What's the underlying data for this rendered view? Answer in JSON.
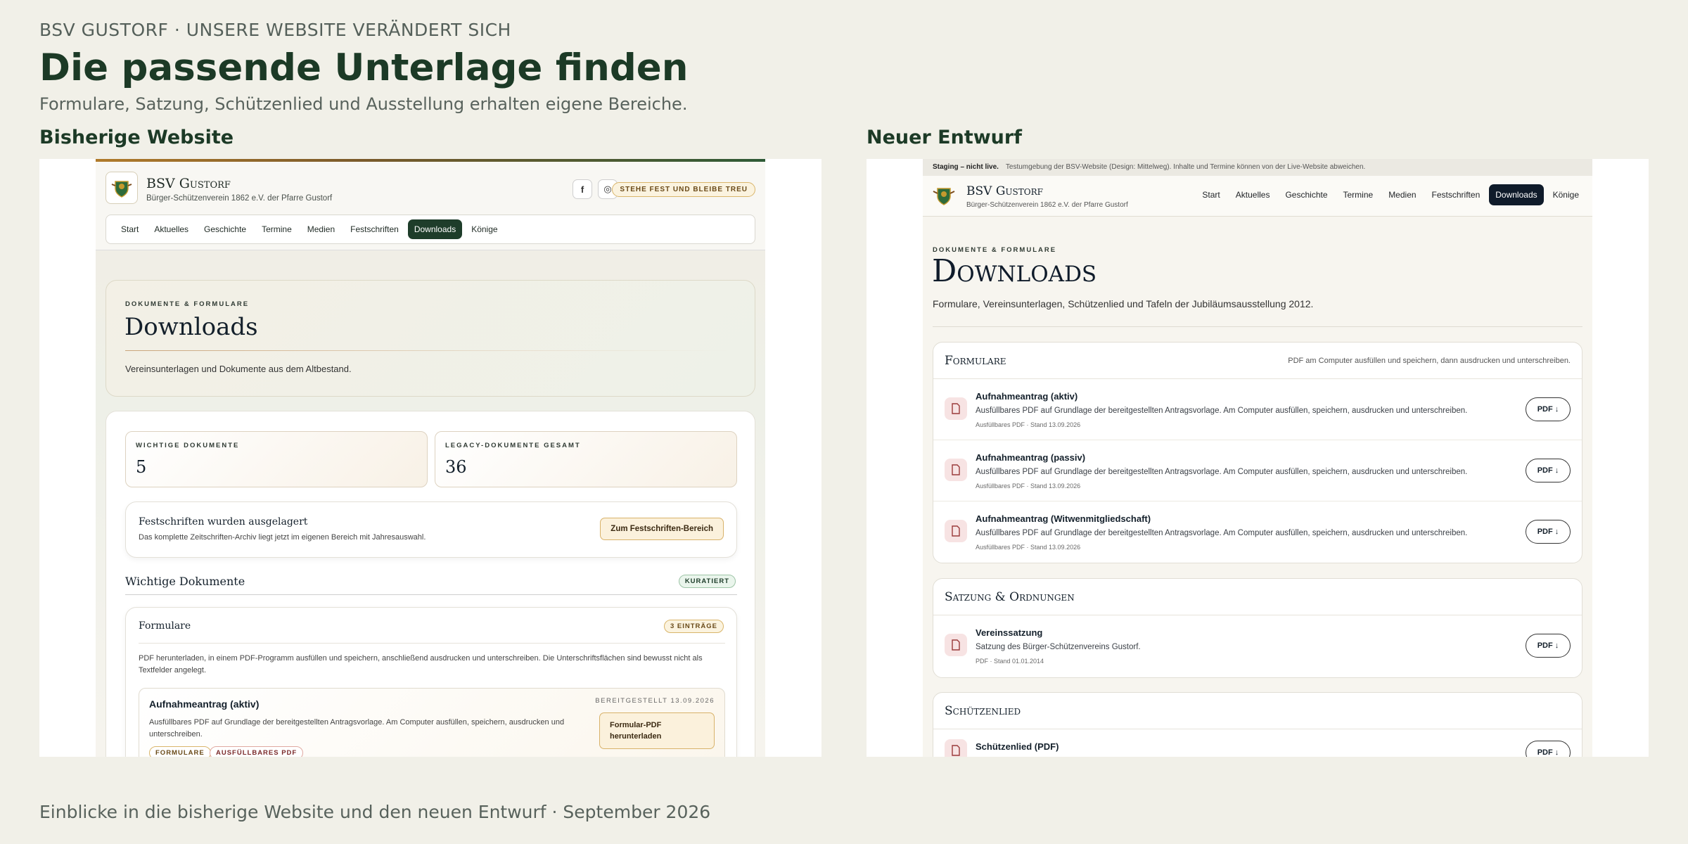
{
  "header": {
    "kicker": "BSV GUSTORF · UNSERE WEBSITE VERÄNDERT SICH",
    "title": "Die passende Unterlage finden",
    "subtitle": "Formulare, Satzung, Schützenlied und Ausstellung erhalten eigene Bereiche."
  },
  "columns": {
    "left": "Bisherige Website",
    "right": "Neuer Entwurf"
  },
  "footer": "Einblicke in die bisherige Website und den neuen Entwurf · September 2026",
  "old": {
    "brand": "BSV Gustorf",
    "tagline": "Bürger-Schützenverein 1862 e.V. der Pfarre Gustorf",
    "social": {
      "facebook": "f",
      "instagram": "◎"
    },
    "motto": "STEHE FEST UND BLEIBE TREU",
    "nav": [
      "Start",
      "Aktuelles",
      "Geschichte",
      "Termine",
      "Medien",
      "Festschriften",
      "Downloads",
      "Könige"
    ],
    "hero": {
      "eyebrow": "DOKUMENTE & FORMULARE",
      "title": "Downloads",
      "text": "Vereinsunterlagen und Dokumente aus dem Altbestand."
    },
    "stats": [
      {
        "label": "WICHTIGE DOKUMENTE",
        "value": "5"
      },
      {
        "label": "LEGACY-DOKUMENTE GESAMT",
        "value": "36"
      }
    ],
    "notice": {
      "title": "Festschriften wurden ausgelagert",
      "text": "Das komplette Zeitschriften-Archiv liegt jetzt im eigenen Bereich mit Jahresauswahl.",
      "button": "Zum Festschriften-Bereich"
    },
    "important": {
      "title": "Wichtige Dokumente",
      "badge": "KURATIERT"
    },
    "group": {
      "title": "Formulare",
      "badge": "3 EINTRÄGE",
      "text": "PDF herunterladen, in einem PDF-Programm ausfüllen und speichern, anschließend ausdrucken und unterschreiben. Die Unterschriftsflächen sind bewusst nicht als Textfelder angelegt."
    },
    "item": {
      "title": "Aufnahmeantrag (aktiv)",
      "text": "Ausfüllbares PDF auf Grundlage der bereitgestellten Antragsvorlage. Am Computer ausfüllen, speichern, ausdrucken und unterschreiben.",
      "date": "BEREITGESTELLT 13.09.2026",
      "button": "Formular-PDF herunterladen",
      "tags": [
        "FORMULARE",
        "AUSFÜLLBARES PDF"
      ]
    }
  },
  "new": {
    "staging_label": "Staging – nicht live.",
    "staging_text": "Testumgebung der BSV-Website (Design: Mittelweg). Inhalte und Termine können von der Live-Website abweichen.",
    "brand": "BSV Gustorf",
    "tagline": "Bürger-Schützenverein 1862 e.V. der Pfarre Gustorf",
    "nav": [
      "Start",
      "Aktuelles",
      "Geschichte",
      "Termine",
      "Medien",
      "Festschriften",
      "Downloads",
      "Könige"
    ],
    "eyebrow": "DOKUMENTE & FORMULARE",
    "title": "Downloads",
    "intro": "Formulare, Vereinsunterlagen, Schützenlied und Tafeln der Jubiläumsausstellung 2012.",
    "sections": [
      {
        "title": "Formulare",
        "note": "PDF am Computer ausfüllen und speichern, dann ausdrucken und unterschreiben.",
        "items": [
          {
            "title": "Aufnahmeantrag (aktiv)",
            "desc": "Ausfüllbares PDF auf Grundlage der bereitgestellten Antragsvorlage. Am Computer ausfüllen, speichern, ausdrucken und unterschreiben.",
            "meta": "Ausfüllbares PDF · Stand 13.09.2026",
            "button": "PDF ↓"
          },
          {
            "title": "Aufnahmeantrag (passiv)",
            "desc": "Ausfüllbares PDF auf Grundlage der bereitgestellten Antragsvorlage. Am Computer ausfüllen, speichern, ausdrucken und unterschreiben.",
            "meta": "Ausfüllbares PDF · Stand 13.09.2026",
            "button": "PDF ↓"
          },
          {
            "title": "Aufnahmeantrag (Witwenmitgliedschaft)",
            "desc": "Ausfüllbares PDF auf Grundlage der bereitgestellten Antragsvorlage. Am Computer ausfüllen, speichern, ausdrucken und unterschreiben.",
            "meta": "Ausfüllbares PDF · Stand 13.09.2026",
            "button": "PDF ↓"
          }
        ]
      },
      {
        "title": "Satzung & Ordnungen",
        "items": [
          {
            "title": "Vereinssatzung",
            "desc": "Satzung des Bürger-Schützenvereins Gustorf.",
            "meta": "PDF · Stand 01.01.2014",
            "button": "PDF ↓"
          }
        ]
      },
      {
        "title": "Schützenlied",
        "items": [
          {
            "title": "Schützenlied (PDF)",
            "button": "PDF ↓"
          }
        ]
      }
    ]
  }
}
